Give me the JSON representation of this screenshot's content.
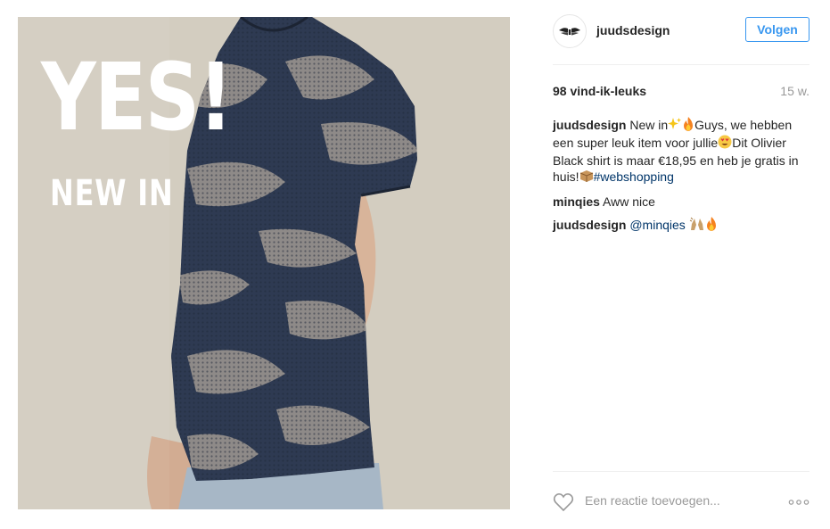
{
  "post": {
    "image": {
      "overlay_big": "YES!",
      "overlay_small": "NEW IN",
      "background_color": "#cfcabc",
      "shirt_color": "#2e3a52",
      "camo_color": "#8e8a88"
    },
    "header": {
      "username": "juudsdesign",
      "follow_label": "Volgen",
      "accent_color": "#3897f0"
    },
    "likes": "98 vind-ik-leuks",
    "time_ago": "15 w.",
    "comments": [
      {
        "user": "juudsdesign",
        "text_1": "New in",
        "text_2": "Guys, we hebben een super leuk item voor jullie",
        "text_3": "Dit Olivier Black shirt is maar €18,95 en heb je gratis in huis!",
        "hashtag": "#webshopping"
      },
      {
        "user": "minqies",
        "text": "Aww nice"
      },
      {
        "user": "juudsdesign",
        "mention": "@minqies"
      }
    ],
    "add_comment": {
      "placeholder": "Een reactie toevoegen...",
      "icons": [
        "heart-icon",
        "more-options-icon"
      ]
    }
  }
}
